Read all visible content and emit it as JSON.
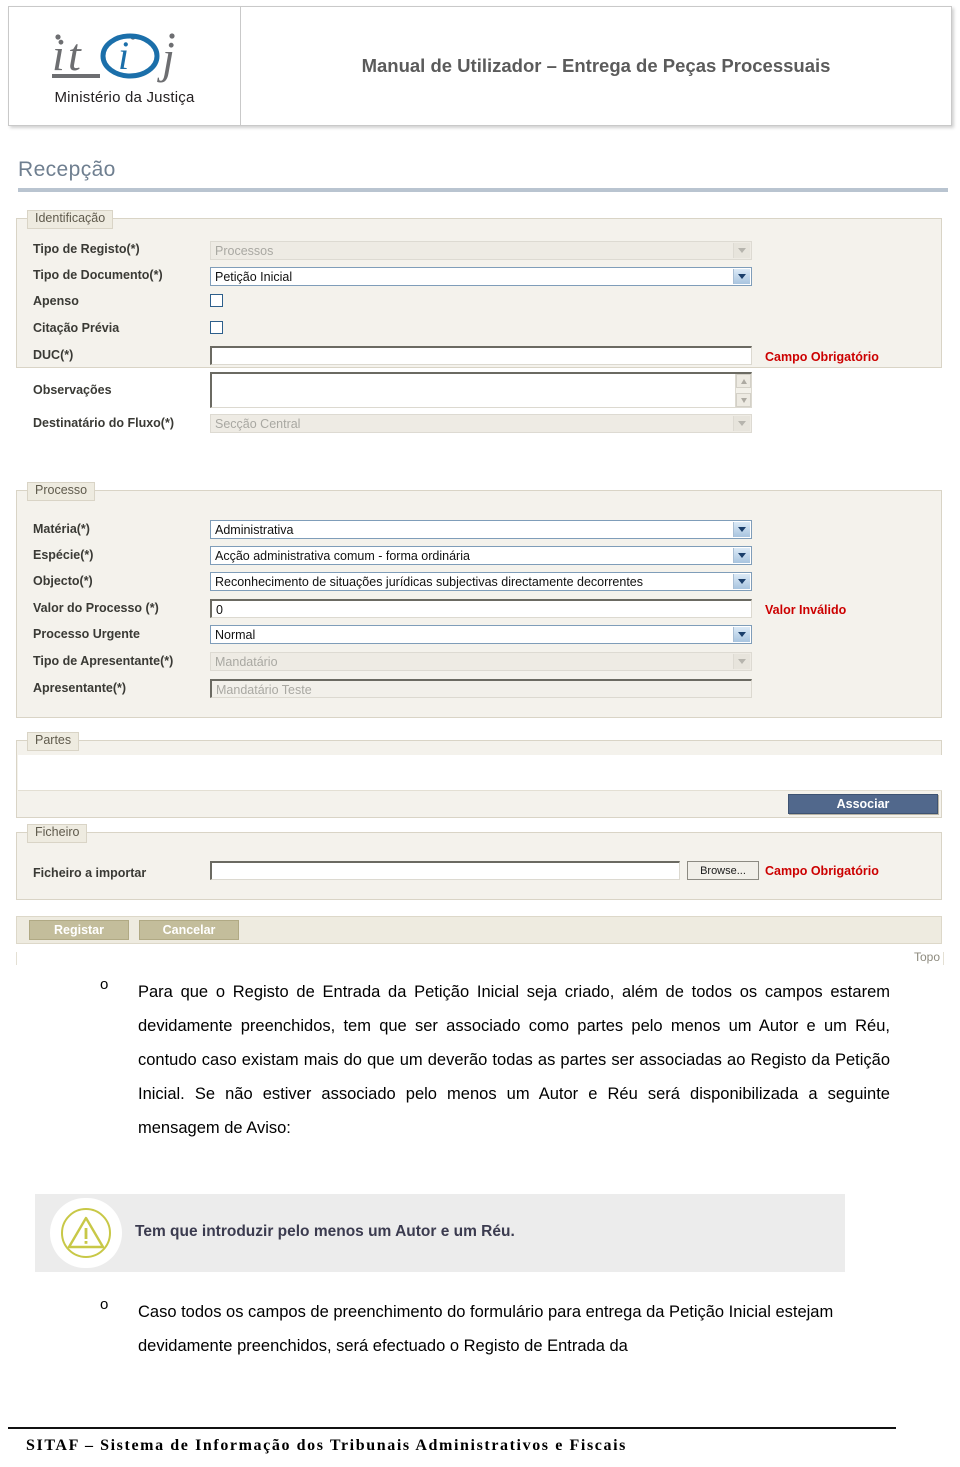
{
  "header": {
    "logo_text": "it(i)j",
    "logo_subtitle": "Ministério da Justiça",
    "title": "Manual de Utilizador – Entrega de Peças Processuais"
  },
  "screen": {
    "page_heading": "Recepção",
    "sections": {
      "identificacao": {
        "legend": "Identificação",
        "fields": [
          {
            "label": "Tipo de Registo(*)",
            "value": "Processos",
            "type": "select",
            "disabled": true
          },
          {
            "label": "Tipo de Documento(*)",
            "value": "Petição Inicial",
            "type": "select",
            "disabled": false
          },
          {
            "label": "Apenso",
            "value": "",
            "type": "checkbox",
            "checked": false
          },
          {
            "label": "Citação Prévia",
            "value": "",
            "type": "checkbox",
            "checked": false
          },
          {
            "label": "DUC(*)",
            "value": "",
            "type": "text",
            "hint": "Campo Obrigatório"
          },
          {
            "label": "Observações",
            "value": "",
            "type": "textarea"
          },
          {
            "label": "Destinatário do Fluxo(*)",
            "value": "Secção Central",
            "type": "select",
            "disabled": true
          }
        ]
      },
      "processo": {
        "legend": "Processo",
        "fields": [
          {
            "label": "Matéria(*)",
            "value": "Administrativa",
            "type": "select",
            "disabled": false
          },
          {
            "label": "Espécie(*)",
            "value": "Acção administrativa comum - forma ordinária",
            "type": "select",
            "disabled": false
          },
          {
            "label": "Objecto(*)",
            "value": "Reconhecimento de situações jurídicas subjectivas directamente decorrentes",
            "type": "select",
            "disabled": false
          },
          {
            "label": "Valor do Processo (*)",
            "value": "0",
            "type": "text",
            "hint": "Valor Inválido"
          },
          {
            "label": "Processo Urgente",
            "value": "Normal",
            "type": "select",
            "disabled": false
          },
          {
            "label": "Tipo de Apresentante(*)",
            "value": "Mandatário",
            "type": "select",
            "disabled": true
          },
          {
            "label": "Apresentante(*)",
            "value": "Mandatário Teste",
            "type": "text",
            "disabled": true
          }
        ]
      },
      "partes": {
        "legend": "Partes",
        "associar_label": "Associar"
      },
      "ficheiro": {
        "legend": "Ficheiro",
        "field_label": "Ficheiro a importar",
        "field_value": "",
        "browse_label": "Browse...",
        "hint": "Campo Obrigatório"
      }
    },
    "actions": {
      "registar_label": "Registar",
      "cancelar_label": "Cancelar",
      "topo_label": "Topo"
    }
  },
  "body": {
    "bullet_marker": "o",
    "paragraph_1": "Para que o Registo de Entrada da Petição Inicial seja criado, além de todos os campos estarem devidamente preenchidos, tem que ser associado como partes pelo menos um Autor e um Réu, contudo caso existam mais do que um deverão todas as partes ser associadas ao Registo da Petição Inicial. Se não estiver associado pelo menos um Autor e Réu será disponibilizada a seguinte mensagem de Aviso:",
    "warning_message": "Tem que introduzir pelo menos um Autor e um Réu.",
    "paragraph_2": "Caso todos os campos de preenchimento do formulário para entrega da Petição Inicial estejam devidamente preenchidos, será efectuado o Registo de Entrada da"
  },
  "footer": {
    "text": "SITAF – Sistema de Informação dos Tribunais Administrativos e Fiscais"
  },
  "colors": {
    "header_title": "#5b5b5b",
    "heading": "#6f7f90",
    "panel_bg": "#f4f2ec",
    "error_text": "#cc0000",
    "associar_bg": "#51688c",
    "action_btn_bg": "#c3bd9b",
    "warning_bg": "#ececec",
    "warning_icon": "#c8c847"
  }
}
